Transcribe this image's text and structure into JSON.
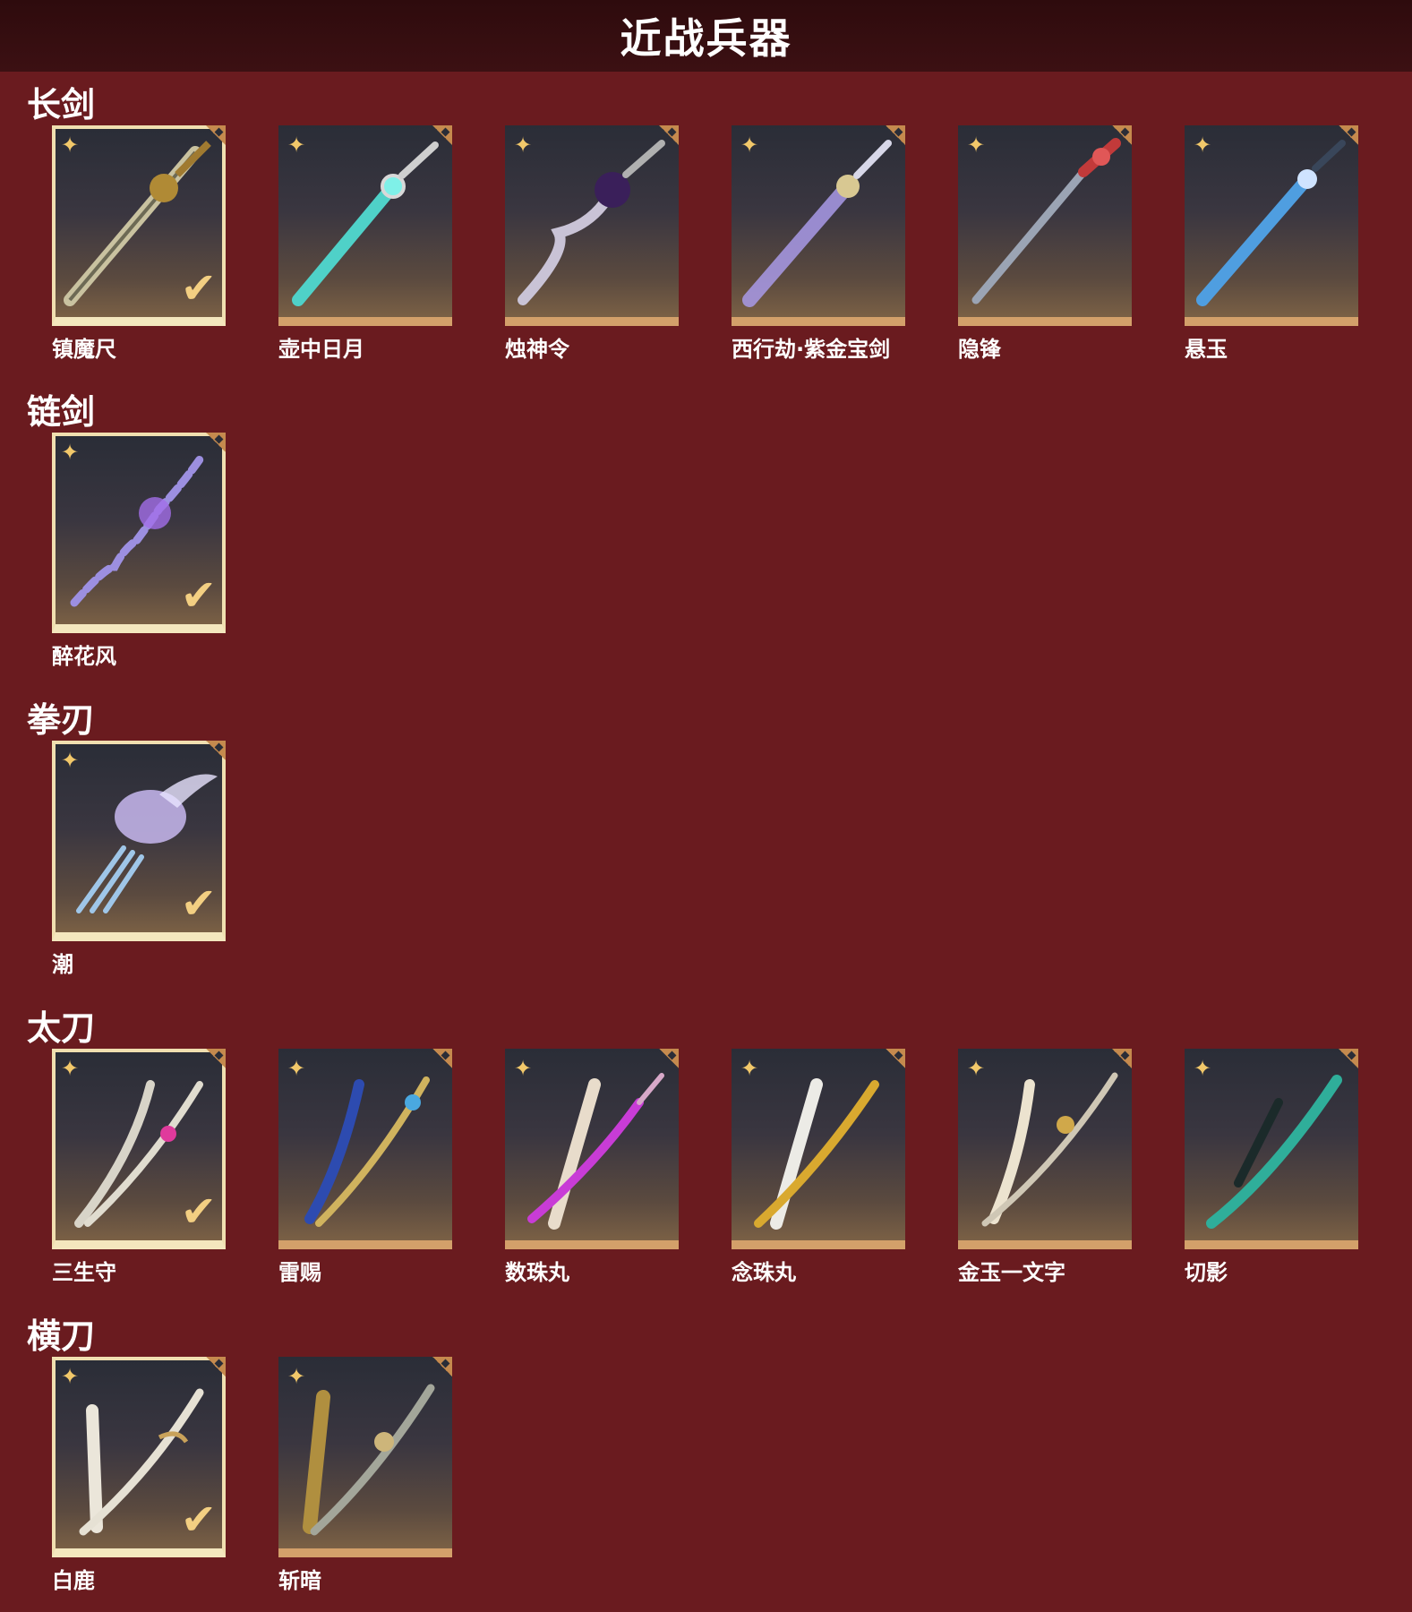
{
  "header": {
    "title": "近战兵器"
  },
  "categories": [
    {
      "title": "长剑",
      "items": [
        {
          "name": "镇魔尺",
          "owned": true
        },
        {
          "name": "壶中日月",
          "owned": false
        },
        {
          "name": "烛神令",
          "owned": false
        },
        {
          "name": "西行劫·紫金宝剑",
          "owned": false
        },
        {
          "name": "隐锋",
          "owned": false
        },
        {
          "name": "悬玉",
          "owned": false
        }
      ]
    },
    {
      "title": "链剑",
      "items": [
        {
          "name": "醉花风",
          "owned": true
        }
      ]
    },
    {
      "title": "拳刃",
      "items": [
        {
          "name": "潮",
          "owned": true
        }
      ]
    },
    {
      "title": "太刀",
      "items": [
        {
          "name": "三生守",
          "owned": true
        },
        {
          "name": "雷赐",
          "owned": false
        },
        {
          "name": "数珠丸",
          "owned": false
        },
        {
          "name": "念珠丸",
          "owned": false
        },
        {
          "name": "金玉一文字",
          "owned": false
        },
        {
          "name": "切影",
          "owned": false
        }
      ]
    },
    {
      "title": "横刀",
      "items": [
        {
          "name": "白鹿",
          "owned": true
        },
        {
          "name": "斩暗",
          "owned": false
        }
      ]
    }
  ],
  "icons": {
    "rarity": "rarity-star-icon",
    "check": "owned-check-icon",
    "corner": "corner-tab-icon"
  },
  "colors": {
    "background": "#6a1b1f",
    "header": "#2e0b0d",
    "accent": "#d3a06a",
    "selected_border": "#f0dfb0"
  }
}
